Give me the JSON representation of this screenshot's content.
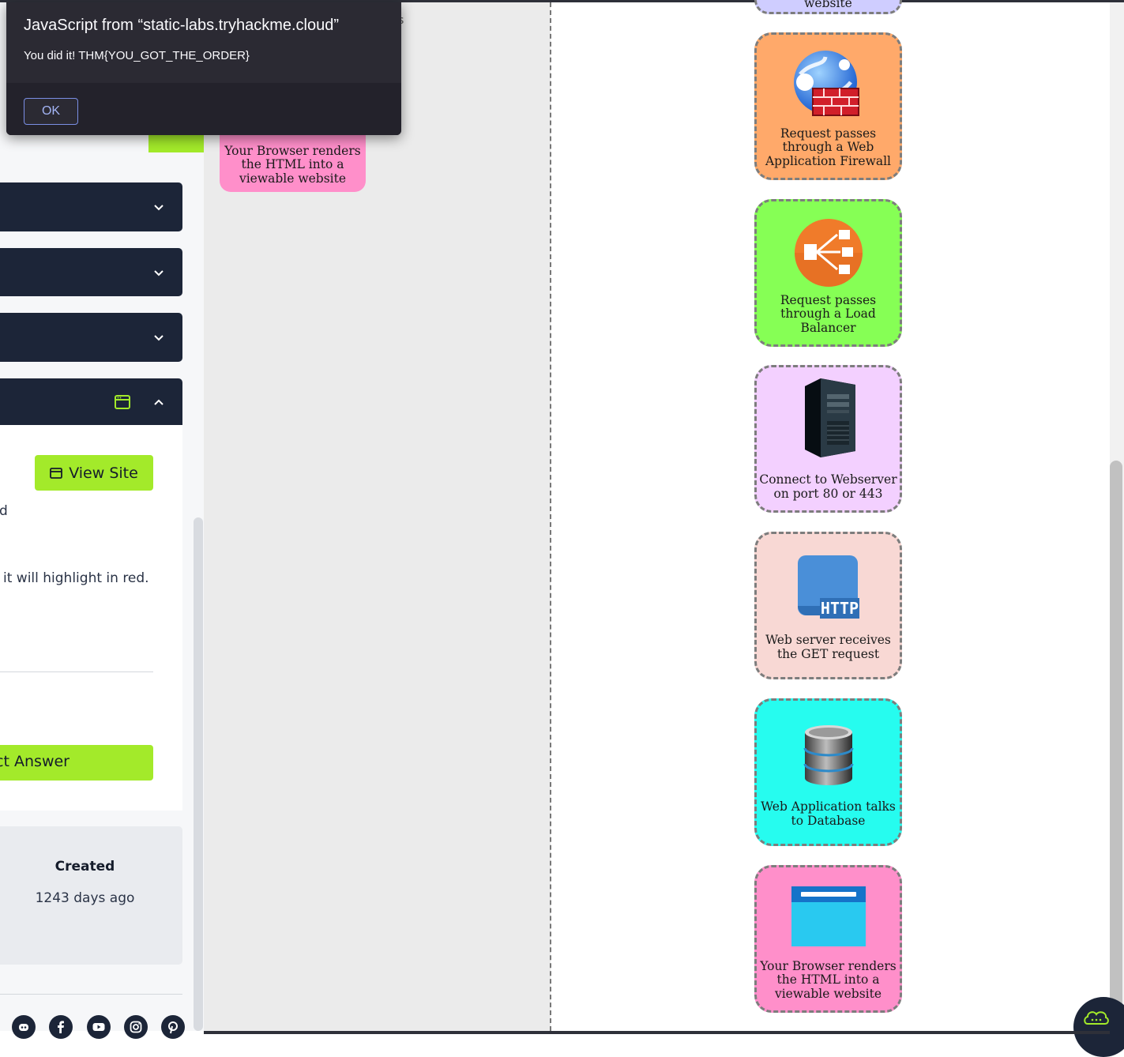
{
  "dialog": {
    "title": "JavaScript from “static-labs.tryhackme.cloud”",
    "message": "You did it! THM{YOU_GOT_THE_ORDER}",
    "ok_label": "OK",
    "behind_text": "s"
  },
  "left_panel": {
    "view_site_label": "View Site",
    "partial_text_1": "d",
    "partial_text_2": "it will highlight in red.",
    "submit_label": "ct Answer",
    "created_label": "Created",
    "created_value": "1243 days ago",
    "social_icons": [
      "discord-icon",
      "facebook-icon",
      "youtube-icon",
      "instagram-icon",
      "pinterest-icon"
    ]
  },
  "middle_card": {
    "text": "Your Browser renders the HTML into a viewable website"
  },
  "diagram": {
    "partial_top_text": "website",
    "steps": [
      {
        "label": "Request passes through a Web Application Firewall",
        "icon": "firewall-icon",
        "color": "#ffa96a"
      },
      {
        "label": "Request passes through a Load Balancer",
        "icon": "load-balancer-icon",
        "color": "#86ff55"
      },
      {
        "label": "Connect to Webserver on port 80 or 443",
        "icon": "server-icon",
        "color": "#f3d0ff"
      },
      {
        "label": "Web server receives the GET request",
        "icon": "http-icon",
        "color": "#f8d8d4"
      },
      {
        "label": "Web Application talks to Database",
        "icon": "database-icon",
        "color": "#26fcef"
      },
      {
        "label": "Your Browser renders the HTML into a viewable website",
        "icon": "browser-window-icon",
        "color": "#ff8fca"
      }
    ]
  },
  "colors": {
    "accent_green": "#a3ea2a",
    "navy": "#1c2538",
    "dialog_bg": "#2b2a33"
  }
}
